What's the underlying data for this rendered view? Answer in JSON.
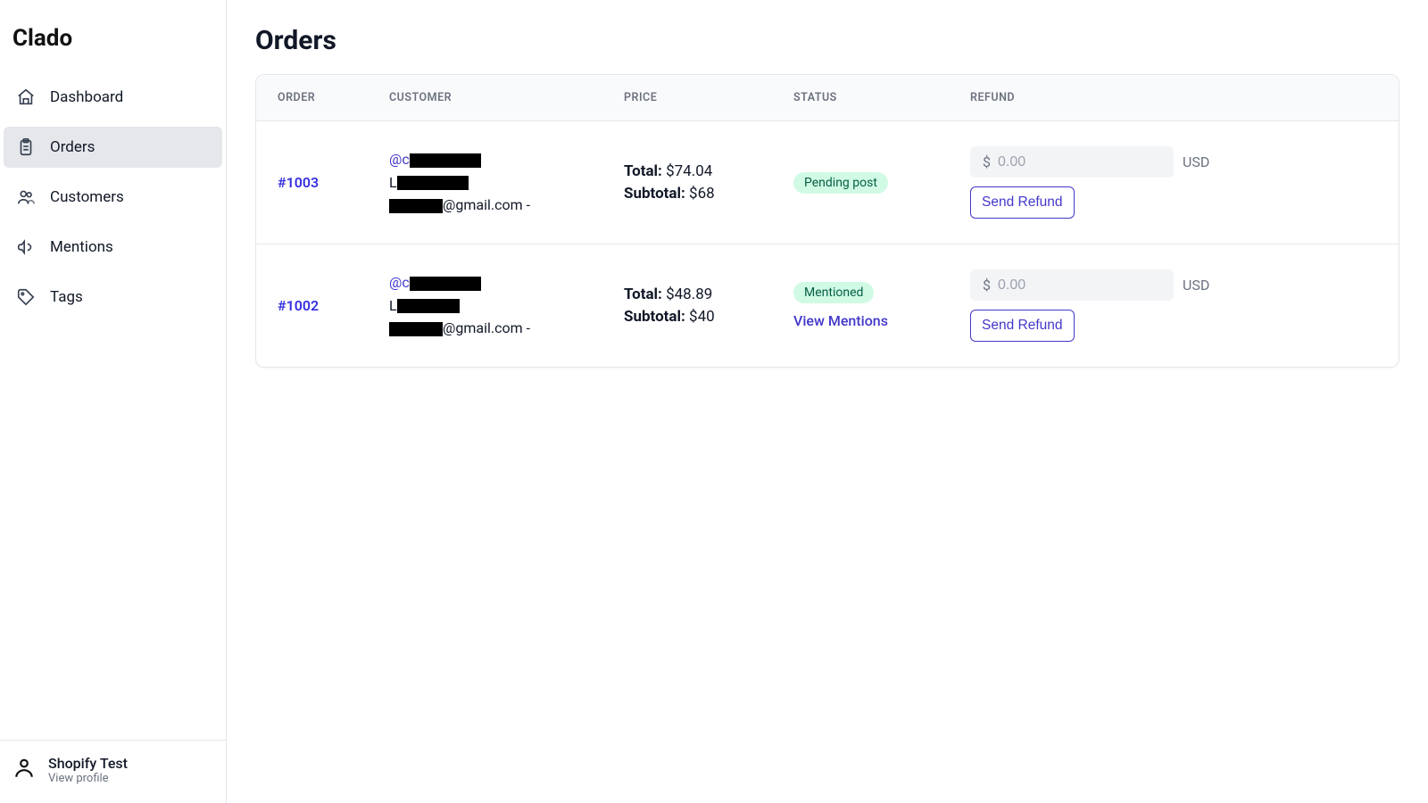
{
  "brand": "Clado",
  "sidebar": {
    "items": [
      {
        "label": "Dashboard",
        "icon": "home-icon",
        "active": false
      },
      {
        "label": "Orders",
        "icon": "clipboard-icon",
        "active": true
      },
      {
        "label": "Customers",
        "icon": "users-icon",
        "active": false
      },
      {
        "label": "Mentions",
        "icon": "megaphone-icon",
        "active": false
      },
      {
        "label": "Tags",
        "icon": "tag-icon",
        "active": false
      }
    ]
  },
  "profile": {
    "name": "Shopify Test",
    "subtitle": "View profile"
  },
  "page": {
    "title": "Orders"
  },
  "table": {
    "columns": [
      "ORDER",
      "CUSTOMER",
      "PRICE",
      "STATUS",
      "REFUND"
    ],
    "rows": [
      {
        "order_id": "#1003",
        "customer": {
          "handle_prefix": "@c",
          "name_prefix": "L",
          "email_suffix": "@gmail.com -"
        },
        "price": {
          "total_label": "Total:",
          "total_value": "$74.04",
          "subtotal_label": "Subtotal:",
          "subtotal_value": "$68"
        },
        "status": {
          "badge": "Pending post",
          "view_mentions": null
        },
        "refund": {
          "currency_symbol": "$",
          "placeholder": "0.00",
          "currency_code": "USD",
          "button": "Send Refund"
        }
      },
      {
        "order_id": "#1002",
        "customer": {
          "handle_prefix": "@c",
          "name_prefix": "L",
          "email_suffix": "@gmail.com -"
        },
        "price": {
          "total_label": "Total:",
          "total_value": "$48.89",
          "subtotal_label": "Subtotal:",
          "subtotal_value": "$40"
        },
        "status": {
          "badge": "Mentioned",
          "view_mentions": "View Mentions"
        },
        "refund": {
          "currency_symbol": "$",
          "placeholder": "0.00",
          "currency_code": "USD",
          "button": "Send Refund"
        }
      }
    ]
  }
}
